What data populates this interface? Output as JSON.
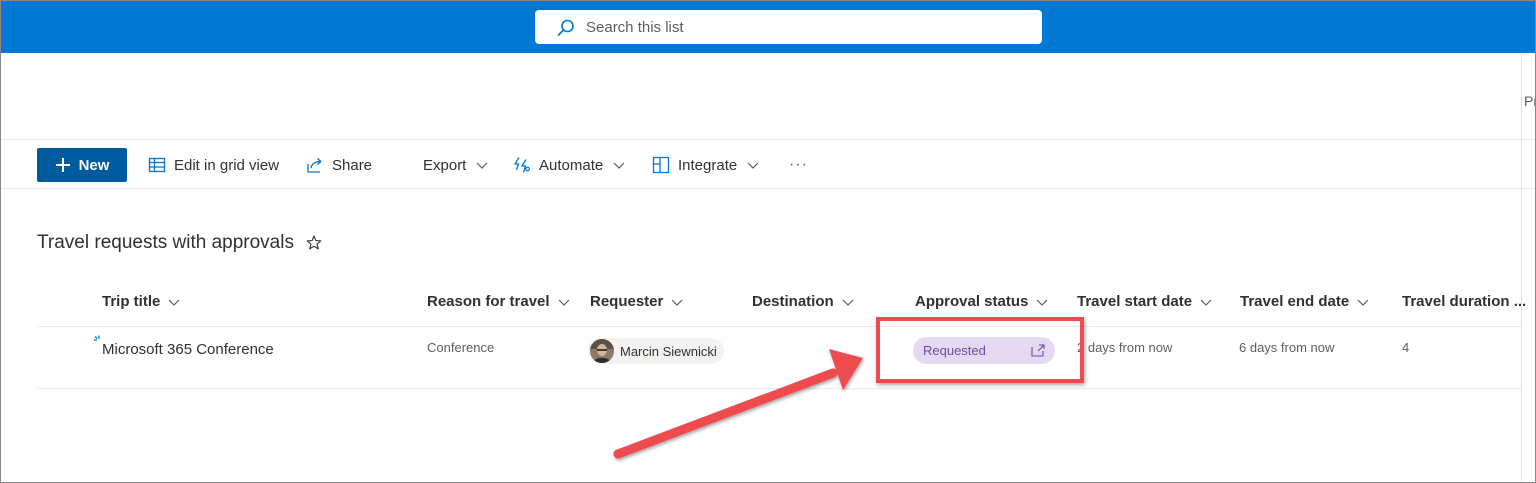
{
  "search": {
    "placeholder": "Search this list"
  },
  "header": {
    "cut_text": "Pr"
  },
  "commandbar": {
    "new_label": "New",
    "edit_grid_label": "Edit in grid view",
    "share_label": "Share",
    "export_label": "Export",
    "automate_label": "Automate",
    "integrate_label": "Integrate",
    "more_label": "···"
  },
  "list": {
    "title": "Travel requests with approvals",
    "columns": [
      "Trip title",
      "Reason for travel",
      "Requester",
      "Destination",
      "Approval status",
      "Travel start date",
      "Travel end date",
      "Travel duration ..."
    ],
    "rows": [
      {
        "trip_title": "Microsoft 365 Conference",
        "reason": "Conference",
        "requester": "Marcin Siewnicki",
        "destination": "",
        "approval_status": "Requested",
        "start_date": "2 days from now",
        "end_date": "6 days from now",
        "duration": "4"
      }
    ]
  },
  "colors": {
    "suite_bar": "#0078d4",
    "new_button": "#005a9e",
    "status_pill_bg": "#e3d9f1",
    "status_pill_text": "#6b4d9e",
    "annotation_red": "#ee4b4f"
  },
  "icons": {
    "search": "search-icon",
    "plus": "plus-icon",
    "grid": "grid-icon",
    "share": "share-icon",
    "automate": "automate-icon",
    "integrate": "integrate-icon",
    "star": "star-icon",
    "open": "open-in-new-icon"
  }
}
